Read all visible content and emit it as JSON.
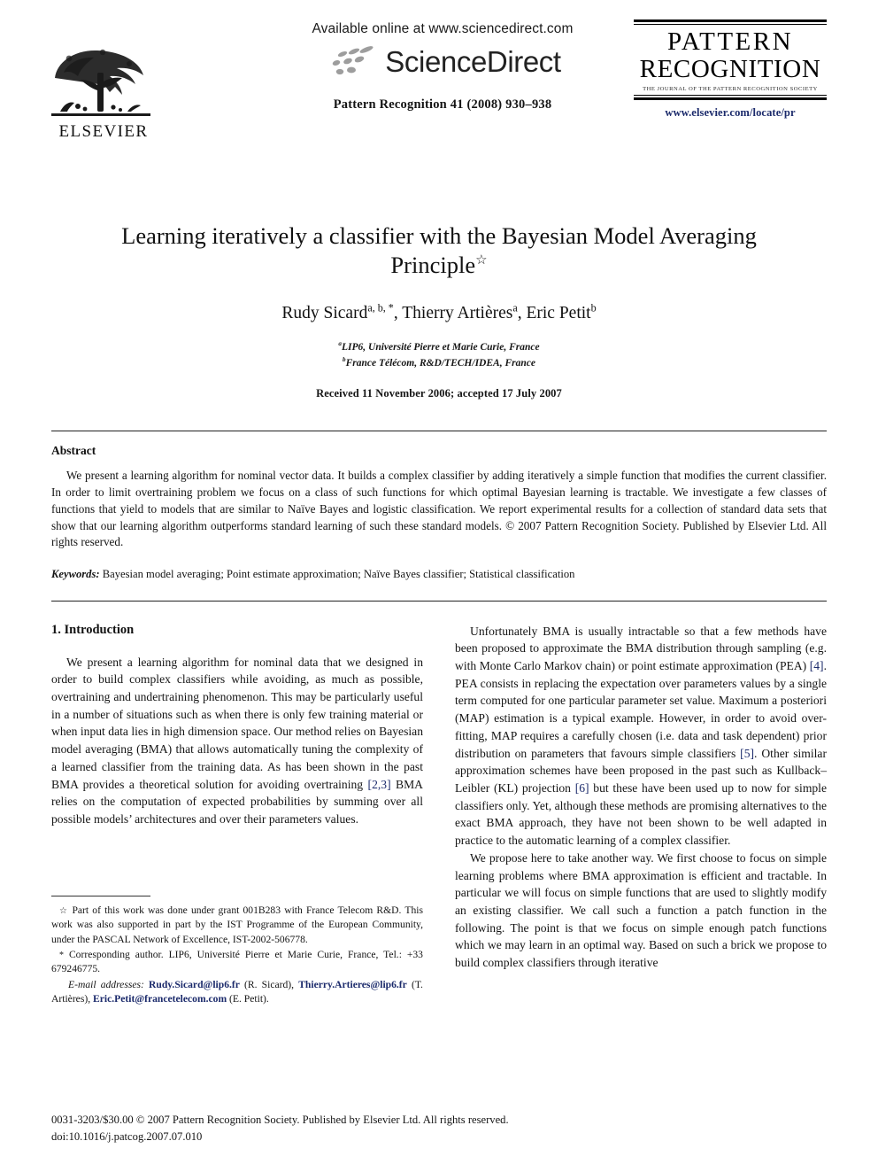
{
  "masthead": {
    "elsevier": {
      "wordmark": "ELSEVIER",
      "logo_name": "elsevier-tree-logo"
    },
    "sciencedirect": {
      "available_line": "Available online at www.sciencedirect.com",
      "wordmark": "ScienceDirect",
      "citation": "Pattern Recognition 41 (2008) 930–938"
    },
    "journal": {
      "title_line1": "PATTERN",
      "title_line2": "RECOGNITION",
      "subtitle": "THE JOURNAL OF THE PATTERN RECOGNITION SOCIETY",
      "url": "www.elsevier.com/locate/pr",
      "url_color": "#1b2a6b"
    }
  },
  "article": {
    "title": "Learning iteratively a classifier with the Bayesian Model Averaging Principle",
    "title_footnote_marker": "☆",
    "authors_html": "Rudy Sicard, Thierry Artières, Eric Petit",
    "author_list": [
      {
        "name": "Rudy Sicard",
        "marks": "a, b, *"
      },
      {
        "name": "Thierry Artières",
        "marks": "a"
      },
      {
        "name": "Eric Petit",
        "marks": "b"
      }
    ],
    "affiliations": [
      {
        "mark": "a",
        "text": "LIP6, Université Pierre et Marie Curie, France"
      },
      {
        "mark": "b",
        "text": "France Télécom, R&D/TECH/IDEA, France"
      }
    ],
    "received": "Received 11 November 2006; accepted 17 July 2007"
  },
  "abstract": {
    "heading": "Abstract",
    "text": "We present a learning algorithm for nominal vector data. It builds a complex classifier by adding iteratively a simple function that modifies the current classifier. In order to limit overtraining problem we focus on a class of such functions for which optimal Bayesian learning is tractable. We investigate a few classes of functions that yield to models that are similar to Naïve Bayes and logistic classification. We report experimental results for a collection of standard data sets that show that our learning algorithm outperforms standard learning of such these standard models.",
    "copyright": "© 2007 Pattern Recognition Society. Published by Elsevier Ltd. All rights reserved.",
    "keywords_label": "Keywords:",
    "keywords": "Bayesian model averaging; Point estimate approximation; Naïve Bayes classifier; Statistical classification"
  },
  "body": {
    "section1_heading": "1.  Introduction",
    "left_para_1_a": "We present a learning algorithm for nominal data that we designed in order to build complex classifiers while avoiding, as much as possible, overtraining and undertraining phenomenon. This may be particularly useful in a number of situations such as when there is only few training material or when input data lies in high dimension space. Our method relies on Bayesian model averaging (BMA) that allows automatically tuning the complexity of a learned classifier from the training data. As has been shown in the past BMA provides a theoretical solution for avoiding overtraining ",
    "left_para_1_ref": "[2,3]",
    "left_para_1_b": " BMA relies on the computation of expected probabilities by summing over all possible models’ architectures and over their parameters values.",
    "right_para_1_a": "Unfortunately BMA is usually intractable so that a few methods have been proposed to approximate the BMA distribution through sampling (e.g. with Monte Carlo Markov chain) or point estimate approximation (PEA) ",
    "right_para_1_ref1": "[4]",
    "right_para_1_b": ". PEA consists in replacing the expectation over parameters values by a single term computed for one particular parameter set value. Maximum a posteriori (MAP) estimation is a typical example. However, in order to avoid over-fitting, MAP requires a carefully chosen (i.e. data and task dependent) prior distribution on parameters that favours simple classifiers ",
    "right_para_1_ref2": "[5]",
    "right_para_1_c": ". Other similar approximation schemes have been proposed in the past such as Kullback–Leibler (KL) projection ",
    "right_para_1_ref3": "[6]",
    "right_para_1_d": " but these have been used up to now for simple classifiers only. Yet, although these methods are promising alternatives to the exact BMA approach, they have not been shown to be well adapted in practice to the automatic learning of a complex classifier.",
    "right_para_2": "We propose here to take another way. We first choose to focus on simple learning problems where BMA approximation is efficient and tractable. In particular we will focus on simple functions that are used to slightly modify an existing classifier. We call such a function a patch function in the following. The point is that we focus on simple enough patch functions which we may learn in an optimal way. Based on such a brick we propose to build complex classifiers through iterative"
  },
  "footnotes": {
    "grant_marker": "☆",
    "grant_text": "Part of this work was done under grant 001B283 with France Telecom R&D. This work was also supported in part by the IST Programme of the European Community, under the PASCAL Network of Excellence, IST-2002-506778.",
    "corresponding_marker": "*",
    "corresponding_text": "Corresponding author. LIP6, Université Pierre et Marie Curie, France, Tel.: +33 679246775.",
    "email_label": "E-mail addresses:",
    "emails": [
      {
        "address": "Rudy.Sicard@lip6.fr",
        "owner": "(R. Sicard),"
      },
      {
        "address": "Thierry.Artieres@lip6.fr",
        "owner": "(T. Artières),"
      },
      {
        "address": "Eric.Petit@francetelecom.com",
        "owner": "(E. Petit)."
      }
    ],
    "link_color": "#1b2a6b"
  },
  "page_footer": {
    "issn_line": "0031-3203/$30.00 © 2007 Pattern Recognition Society. Published by Elsevier Ltd. All rights reserved.",
    "doi_line": "doi:10.1016/j.patcog.2007.07.010"
  }
}
